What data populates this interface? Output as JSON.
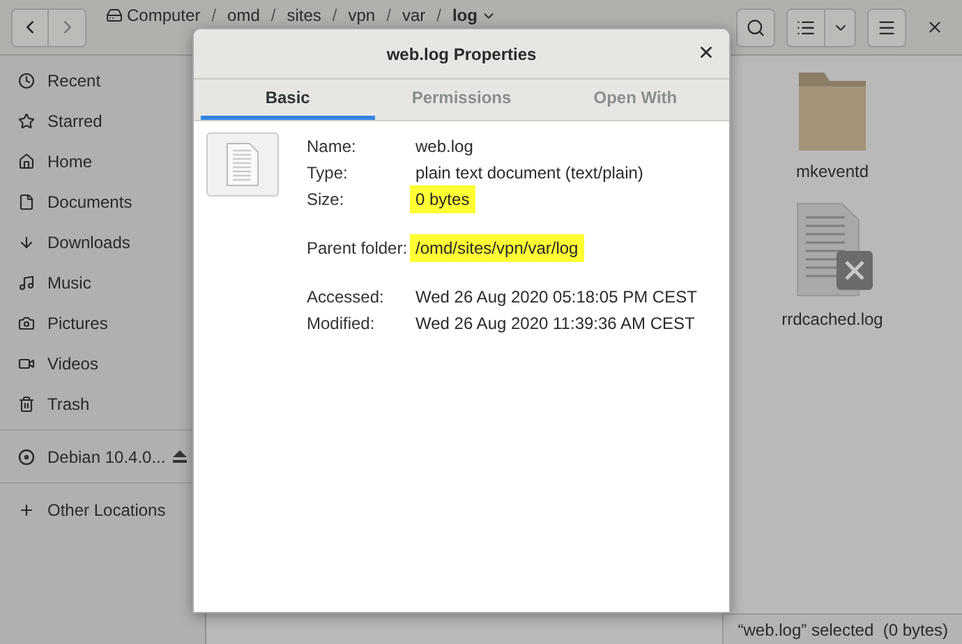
{
  "toolbar": {
    "separator": "/",
    "path": [
      {
        "label": "Computer",
        "kind": "drive"
      },
      {
        "label": "omd",
        "kind": "folder"
      },
      {
        "label": "sites",
        "kind": "folder"
      },
      {
        "label": "vpn",
        "kind": "folder"
      },
      {
        "label": "var",
        "kind": "folder"
      },
      {
        "label": "log",
        "kind": "current"
      }
    ]
  },
  "sidebar": {
    "items": [
      {
        "label": "Recent"
      },
      {
        "label": "Starred"
      },
      {
        "label": "Home"
      },
      {
        "label": "Documents"
      },
      {
        "label": "Downloads"
      },
      {
        "label": "Music"
      },
      {
        "label": "Pictures"
      },
      {
        "label": "Videos"
      },
      {
        "label": "Trash"
      }
    ],
    "devices": [
      {
        "label": "Debian 10.4.0..."
      }
    ],
    "other": {
      "label": "Other Locations"
    }
  },
  "files": [
    {
      "name": "mkeventd",
      "kind": "folder"
    },
    {
      "name": "rrdcached.log",
      "kind": "unreadable"
    }
  ],
  "status_bar": "“web.log” selected  (0 bytes)",
  "dialog": {
    "title": "web.log Properties",
    "tabs": [
      {
        "label": "Basic",
        "selected": true
      },
      {
        "label": "Permissions",
        "selected": false
      },
      {
        "label": "Open With",
        "selected": false
      }
    ],
    "groups": [
      [
        {
          "label": "Name:",
          "value": "web.log",
          "highlighted": false
        },
        {
          "label": "Type:",
          "value": "plain text document (text/plain)",
          "highlighted": false
        },
        {
          "label": "Size:",
          "value": "0 bytes",
          "highlighted": true
        }
      ],
      [
        {
          "label": "Parent folder:",
          "value": "/omd/sites/vpn/var/log",
          "highlighted": true
        }
      ],
      [
        {
          "label": "Accessed:",
          "value": "Wed 26 Aug 2020 05:18:05 PM CEST",
          "highlighted": false
        },
        {
          "label": "Modified:",
          "value": "Wed 26 Aug 2020 11:39:36 AM CEST",
          "highlighted": false
        }
      ]
    ]
  }
}
